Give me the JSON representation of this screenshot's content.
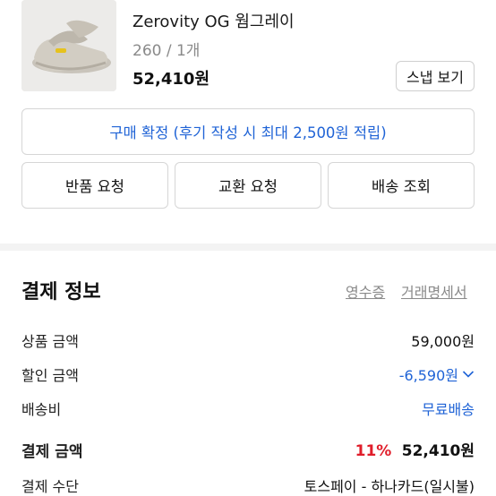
{
  "product": {
    "name": "Zerovity OG 웜그레이",
    "option": "260 / 1개",
    "price": "52,410원",
    "snap_button": "스냅 보기"
  },
  "actions": {
    "confirm": "구매 확정 (후기 작성 시 최대 2,500원 적립)",
    "return": "반품 요청",
    "exchange": "교환 요청",
    "tracking": "배송 조회"
  },
  "payment": {
    "title": "결제 정보",
    "receipt_link": "영수증",
    "statement_link": "거래명세서",
    "rows": {
      "product_amount_label": "상품 금액",
      "product_amount_value": "59,000원",
      "discount_label": "할인 금액",
      "discount_value": "-6,590원",
      "shipping_label": "배송비",
      "shipping_value": "무료배송",
      "total_label": "결제 금액",
      "total_discount_rate": "11%",
      "total_value": "52,410원",
      "method_label": "결제 수단",
      "method_value": "토스페이 - 하나카드(일시불)"
    }
  },
  "colors": {
    "link_blue": "#1f63d6",
    "discount_red": "#e01e2b",
    "border": "#d6d6d6"
  }
}
